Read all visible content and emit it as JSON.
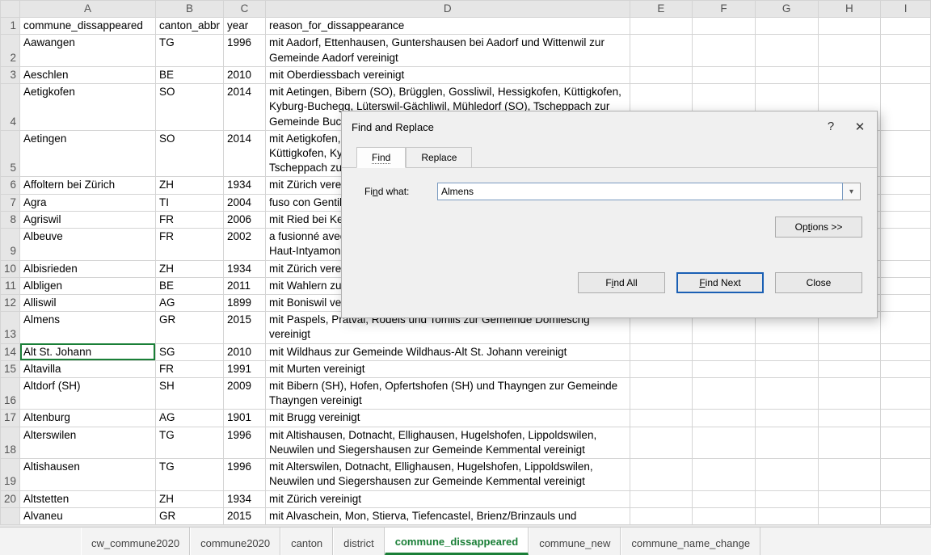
{
  "columns": {
    "A": "A",
    "B": "B",
    "C": "C",
    "D": "D",
    "E": "E",
    "F": "F",
    "G": "G",
    "H": "H",
    "I": "I"
  },
  "header": {
    "A": "commune_dissappeared",
    "B": "canton_abbr",
    "C": "year",
    "D": "reason_for_dissappearance"
  },
  "rows": [
    {
      "n": "2",
      "A": "Aawangen",
      "B": "TG",
      "C": "1996",
      "D": "mit Aadorf, Ettenhausen, Guntershausen bei Aadorf und Wittenwil zur Gemeinde Aadorf vereinigt"
    },
    {
      "n": "3",
      "A": "Aeschlen",
      "B": "BE",
      "C": "2010",
      "D": "mit Oberdiessbach vereinigt"
    },
    {
      "n": "4",
      "A": "Aetigkofen",
      "B": "SO",
      "C": "2014",
      "D": "mit Aetingen, Bibern (SO), Brügglen, Gossliwil, Hessigkofen, Küttigkofen, Kyburg-Buchegg, Lüterswil-Gächliwil, Mühledorf (SO), Tscheppach zur Gemeinde Buchegg vereinigt"
    },
    {
      "n": "5",
      "A": "Aetingen",
      "B": "SO",
      "C": "2014",
      "D": "mit Aetigkofen, Bibern (SO), Brügglen, Gossliwil, Hessigkofen, Küttigkofen, Kyburg-Buchegg, Lüterswil-Gächliwil, Mühledorf (SO), Tscheppach zur Gemeinde Buchegg vereinigt"
    },
    {
      "n": "6",
      "A": "Affoltern bei Zürich",
      "B": "ZH",
      "C": "1934",
      "D": "mit Zürich vereinigt"
    },
    {
      "n": "7",
      "A": "Agra",
      "B": "TI",
      "C": "2004",
      "D": "fuso con Gentilino e Montagnola nel comune di Collina d'Oro"
    },
    {
      "n": "8",
      "A": "Agriswil",
      "B": "FR",
      "C": "2006",
      "D": "mit Ried bei Kerzers vereinigt"
    },
    {
      "n": "9",
      "A": "Albeuve",
      "B": "FR",
      "C": "2002",
      "D": "a fusionné avec Lessoc, Montbovon et Neirivue dans la commune de Haut-Intyamon"
    },
    {
      "n": "10",
      "A": "Albisrieden",
      "B": "ZH",
      "C": "1934",
      "D": "mit Zürich vereinigt"
    },
    {
      "n": "11",
      "A": "Albligen",
      "B": "BE",
      "C": "2011",
      "D": "mit Wahlern zur Gemeinde Schwarzenburg vereinigt"
    },
    {
      "n": "12",
      "A": "Alliswil",
      "B": "AG",
      "C": "1899",
      "D": "mit Boniswil vereinigt"
    },
    {
      "n": "13",
      "A": "Almens",
      "B": "GR",
      "C": "2015",
      "D": "mit Paspels, Pratval, Rodels und Tomils zur Gemeinde Domleschg vereinigt"
    },
    {
      "n": "14",
      "A": "Alt St. Johann",
      "B": "SG",
      "C": "2010",
      "D": "mit Wildhaus zur Gemeinde Wildhaus-Alt St. Johann vereinigt"
    },
    {
      "n": "15",
      "A": "Altavilla",
      "B": "FR",
      "C": "1991",
      "D": "mit Murten vereinigt"
    },
    {
      "n": "16",
      "A": "Altdorf (SH)",
      "B": "SH",
      "C": "2009",
      "D": "mit Bibern (SH), Hofen, Opfertshofen (SH) und Thayngen zur Gemeinde Thayngen vereinigt"
    },
    {
      "n": "17",
      "A": "Altenburg",
      "B": "AG",
      "C": "1901",
      "D": "mit Brugg vereinigt"
    },
    {
      "n": "18",
      "A": "Alterswilen",
      "B": "TG",
      "C": "1996",
      "D": "mit Altishausen, Dotnacht, Ellighausen, Hugelshofen, Lippoldswilen, Neuwilen und Siegershausen zur Gemeinde Kemmental vereinigt"
    },
    {
      "n": "19",
      "A": "Altishausen",
      "B": "TG",
      "C": "1996",
      "D": "mit Alterswilen, Dotnacht, Ellighausen, Hugelshofen, Lippoldswilen, Neuwilen und Siegershausen zur Gemeinde Kemmental vereinigt"
    },
    {
      "n": "20",
      "A": "Altstetten",
      "B": "ZH",
      "C": "1934",
      "D": "mit Zürich vereinigt"
    },
    {
      "n": "",
      "A": "Alvaneu",
      "B": "GR",
      "C": "2015",
      "D": "mit Alvaschein, Mon, Stierva, Tiefencastel, Brienz/Brinzauls und"
    }
  ],
  "selected_row_index": 12,
  "tabs": [
    "cw_commune2020",
    "commune2020",
    "canton",
    "district",
    "commune_dissappeared",
    "commune_new",
    "commune_name_change"
  ],
  "active_tab": 4,
  "dialog": {
    "title": "Find and Replace",
    "tab_find": "Find",
    "tab_replace": "Replace",
    "find_what_label_pre": "Fi",
    "find_what_label_ul": "n",
    "find_what_label_post": "d what:",
    "find_value": "Almens",
    "options_pre": "Op",
    "options_ul": "t",
    "options_post": "ions >>",
    "find_all_pre": "F",
    "find_all_ul": "i",
    "find_all_post": "nd All",
    "find_next_ul": "F",
    "find_next_post": "ind Next",
    "close": "Close"
  }
}
